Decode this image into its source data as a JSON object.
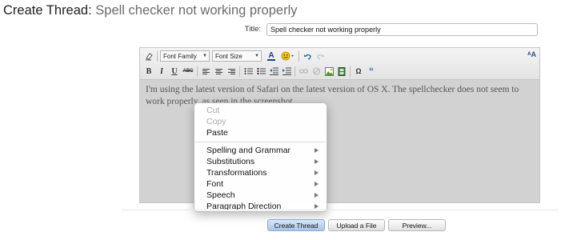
{
  "page": {
    "title_lead": "Create Thread:",
    "title_subject": "Spell checker not working properly"
  },
  "form": {
    "title_label": "Title:",
    "title_value": "Spell checker not working properly"
  },
  "toolbar": {
    "font_family": "Font Family",
    "font_size": "Font Size",
    "bold": "B",
    "italic": "I",
    "underline": "U",
    "strike": "ABC",
    "text_color_glyph": "A",
    "corner_glyph": "ᴬA",
    "insert_char_glyph": "Ω",
    "quote_glyph": "“",
    "icons": [
      "clear-format-icon",
      "text-color-icon",
      "smilies-icon",
      "undo-icon",
      "redo-icon",
      "bold-icon",
      "italic-icon",
      "underline-icon",
      "strikethrough-icon",
      "align-left-icon",
      "align-center-icon",
      "align-right-icon",
      "bulleted-list-icon",
      "numbered-list-icon",
      "outdent-icon",
      "indent-icon",
      "link-icon",
      "unlink-icon",
      "insert-image-icon",
      "insert-media-icon",
      "insert-special-char-icon",
      "quote-icon",
      "toggle-editor-icon"
    ]
  },
  "editor": {
    "body_text": "I'm using the latest version of Safari on the latest version of OS X. The spellchecker does not seem to work properly, as seen in the screenshot."
  },
  "context_menu": {
    "items": [
      {
        "label": "Cut",
        "enabled": false
      },
      {
        "label": "Copy",
        "enabled": false
      },
      {
        "label": "Paste",
        "enabled": true
      },
      {
        "label": "Spelling and Grammar",
        "enabled": true,
        "submenu": true
      },
      {
        "label": "Substitutions",
        "enabled": true,
        "submenu": true
      },
      {
        "label": "Transformations",
        "enabled": true,
        "submenu": true
      },
      {
        "label": "Font",
        "enabled": true,
        "submenu": true
      },
      {
        "label": "Speech",
        "enabled": true,
        "submenu": true
      },
      {
        "label": "Paragraph Direction",
        "enabled": true,
        "submenu": true
      }
    ]
  },
  "buttons": {
    "create": "Create Thread",
    "upload": "Upload a File",
    "preview": "Preview..."
  },
  "colors": {
    "editor_bg": "#d2d2d2",
    "primary_button": "#a9c6e8",
    "subject_text": "#6b6b6b"
  }
}
